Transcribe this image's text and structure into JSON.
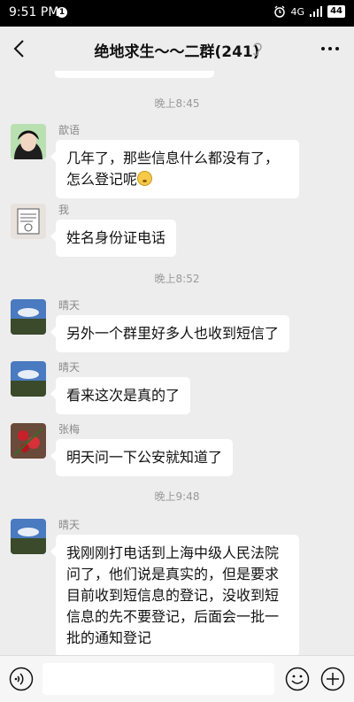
{
  "status_bar": {
    "time": "9:51 PM",
    "notif_badge": "1",
    "signal": "4G",
    "battery": "44"
  },
  "nav": {
    "title": "绝地求生～～二群(241)"
  },
  "input": {
    "placeholder": ""
  },
  "messages": [
    {
      "type": "timestamp",
      "text": "晚上8:45"
    },
    {
      "type": "message",
      "sender": "歆语",
      "text": "几年了，那些信息什么都没有了，怎么登记呢",
      "emoji": "flushed-face"
    },
    {
      "type": "message",
      "sender": "我",
      "text": "姓名身份证电话"
    },
    {
      "type": "timestamp",
      "text": "晚上8:52"
    },
    {
      "type": "message",
      "sender": "晴天",
      "text": "另外一个群里好多人也收到短信了"
    },
    {
      "type": "message",
      "sender": "晴天",
      "text": "看来这次是真的了"
    },
    {
      "type": "message",
      "sender": "张梅",
      "text": "明天问一下公安就知道了"
    },
    {
      "type": "timestamp",
      "text": "晚上9:48"
    },
    {
      "type": "message",
      "sender": "晴天",
      "text": "我刚刚打电话到上海中级人民法院问了，他们说是真实的，但是要求目前收到短信息的登记，没收到短信息的先不要登记，后面会一批一批的通知登记"
    }
  ],
  "colors": {
    "background": "#ededed",
    "bubble": "#ffffff",
    "status_bar": "#000000"
  }
}
